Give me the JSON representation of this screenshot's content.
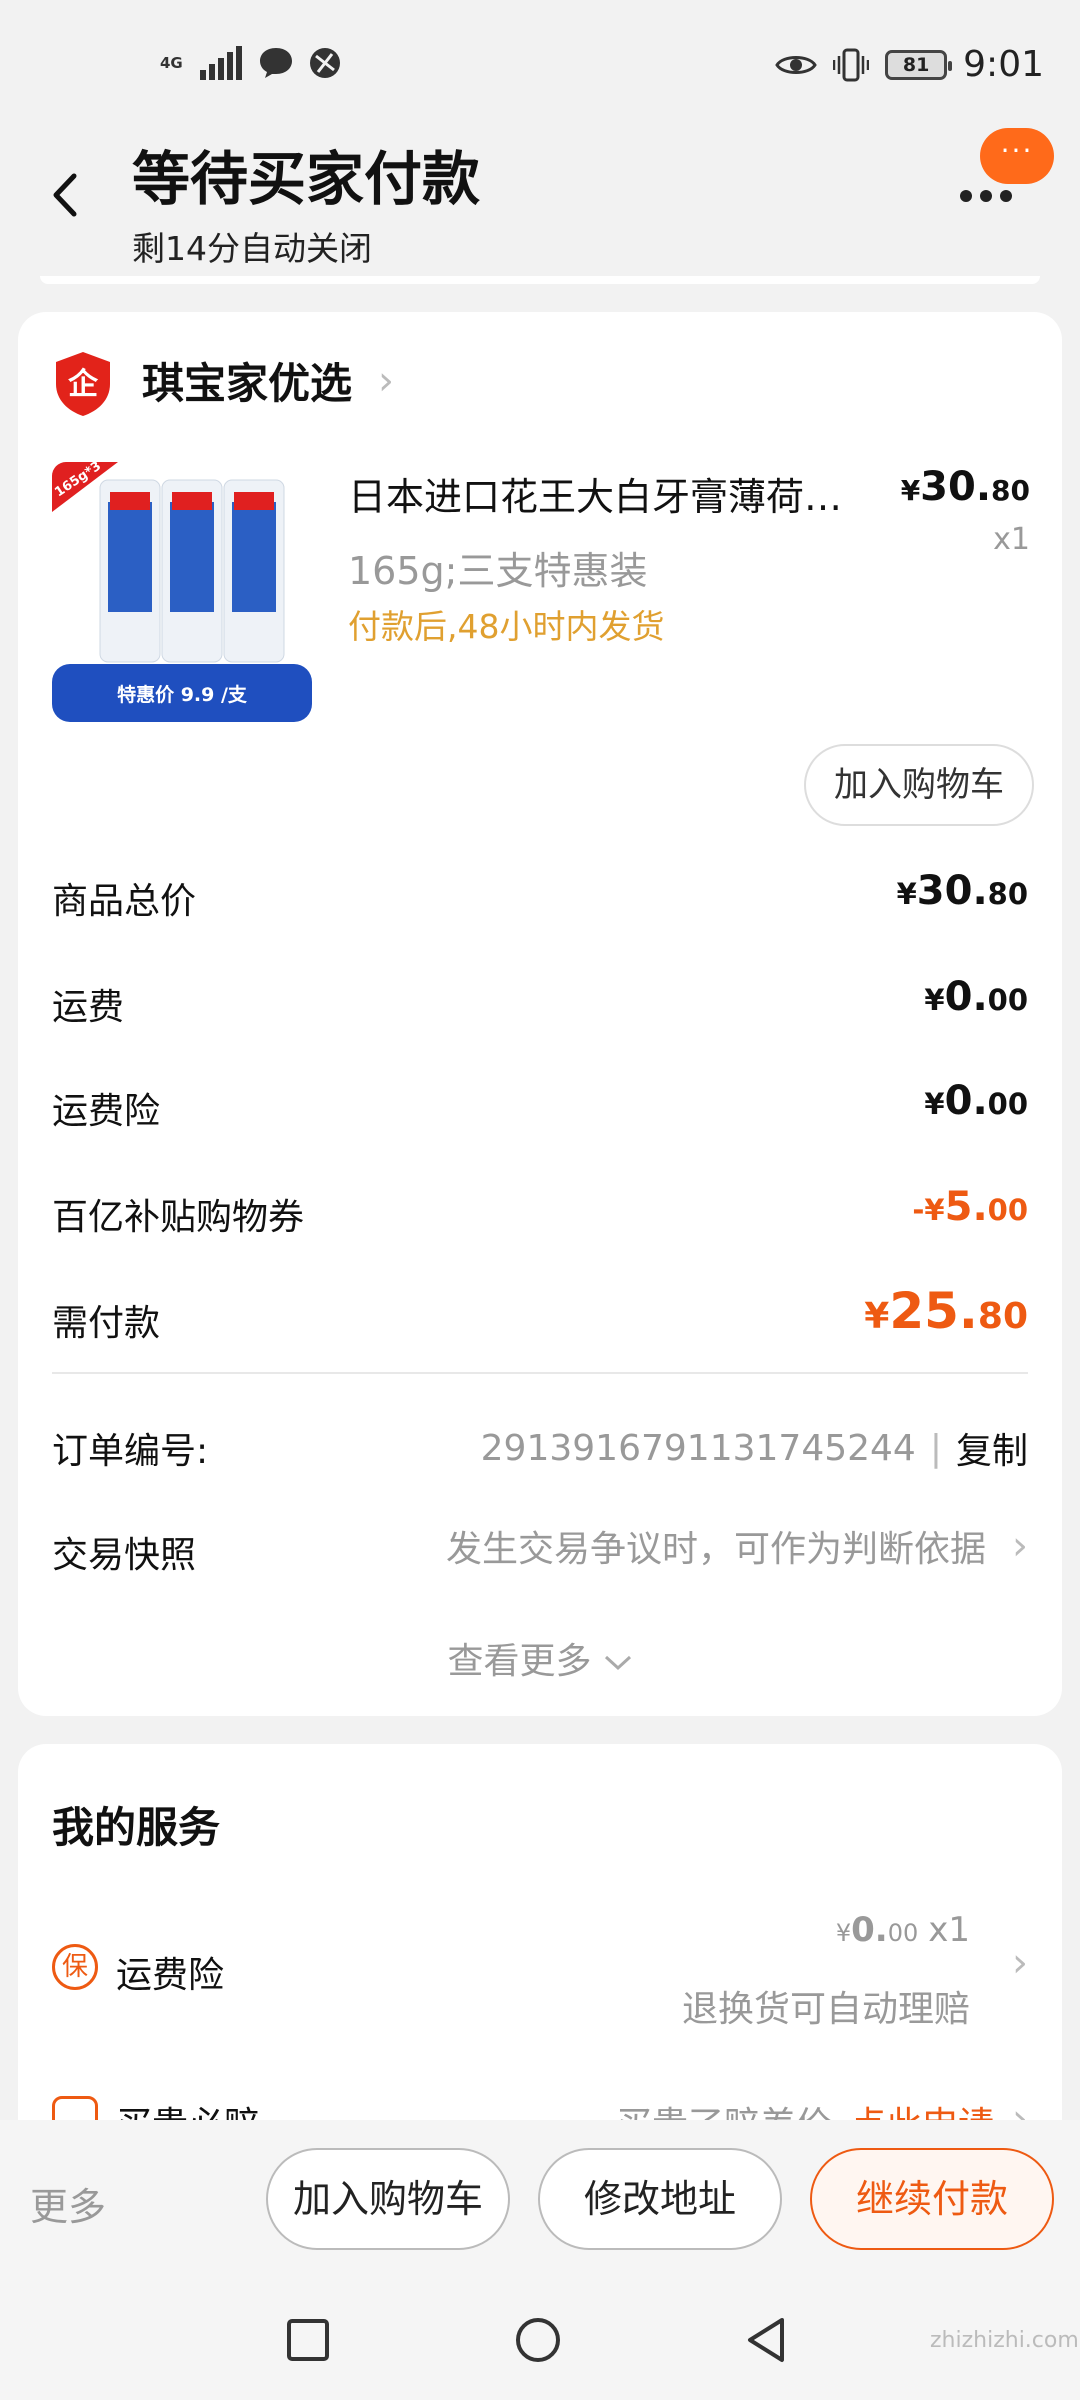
{
  "status_bar": {
    "network": "4G",
    "time": "9:01",
    "battery": "81",
    "icons": [
      "signal-icon",
      "message-icon",
      "vpn-icon",
      "eye-icon",
      "vibrate-icon"
    ]
  },
  "header": {
    "title": "等待买家付款",
    "subtitle": "剩14分自动关闭",
    "chat_badge": "···"
  },
  "shop": {
    "name": "琪宝家优选",
    "logo_text": "企"
  },
  "product": {
    "title": "日本进口花王大白牙膏薄荷…",
    "spec": "165g;三支特惠装",
    "shipping_note": "付款后,48小时内发货",
    "price_symbol": "¥",
    "price_int": "30.",
    "price_dec": "80",
    "qty": "x1",
    "image_banner": "特惠价 9.9 /支",
    "image_corner": "165g*3",
    "add_cart_label": "加入购物车"
  },
  "price_rows": [
    {
      "label": "商品总价",
      "symbol": "¥",
      "int": "30.",
      "dec": "80"
    },
    {
      "label": "运费",
      "symbol": "¥",
      "int": "0.",
      "dec": "00"
    },
    {
      "label": "运费险",
      "symbol": "¥",
      "int": "0.",
      "dec": "00"
    },
    {
      "label": "百亿补贴购物券",
      "symbol": "-¥",
      "int": "5.",
      "dec": "00"
    },
    {
      "label": "需付款",
      "symbol": "¥",
      "int": "25.",
      "dec": "80"
    }
  ],
  "order_info": {
    "order_no_label": "订单编号:",
    "order_no": "2913916791131745244",
    "separator": "|",
    "copy_label": "复制",
    "snapshot_label": "交易快照",
    "snapshot_value": "发生交易争议时，可作为判断依据",
    "see_more": "查看更多"
  },
  "services": {
    "title": "我的服务",
    "items": [
      {
        "icon_char": "保",
        "label": "运费险",
        "price_symbol": "¥",
        "price_int": "0.",
        "price_dec": "00",
        "qty": "x1",
        "desc": "退换货可自动理赔"
      },
      {
        "icon_char": "",
        "label": "买贵必赔",
        "desc": "买贵了赔差价",
        "action": "点此申请"
      }
    ]
  },
  "bottom_bar": {
    "more": "更多",
    "add_cart": "加入购物车",
    "edit_address": "修改地址",
    "continue_pay": "继续付款"
  },
  "watermark": "zhizhizhi.com",
  "colors": {
    "accent": "#ee5a12",
    "shipping_note": "#e0a030",
    "background": "#f2f2f2"
  }
}
